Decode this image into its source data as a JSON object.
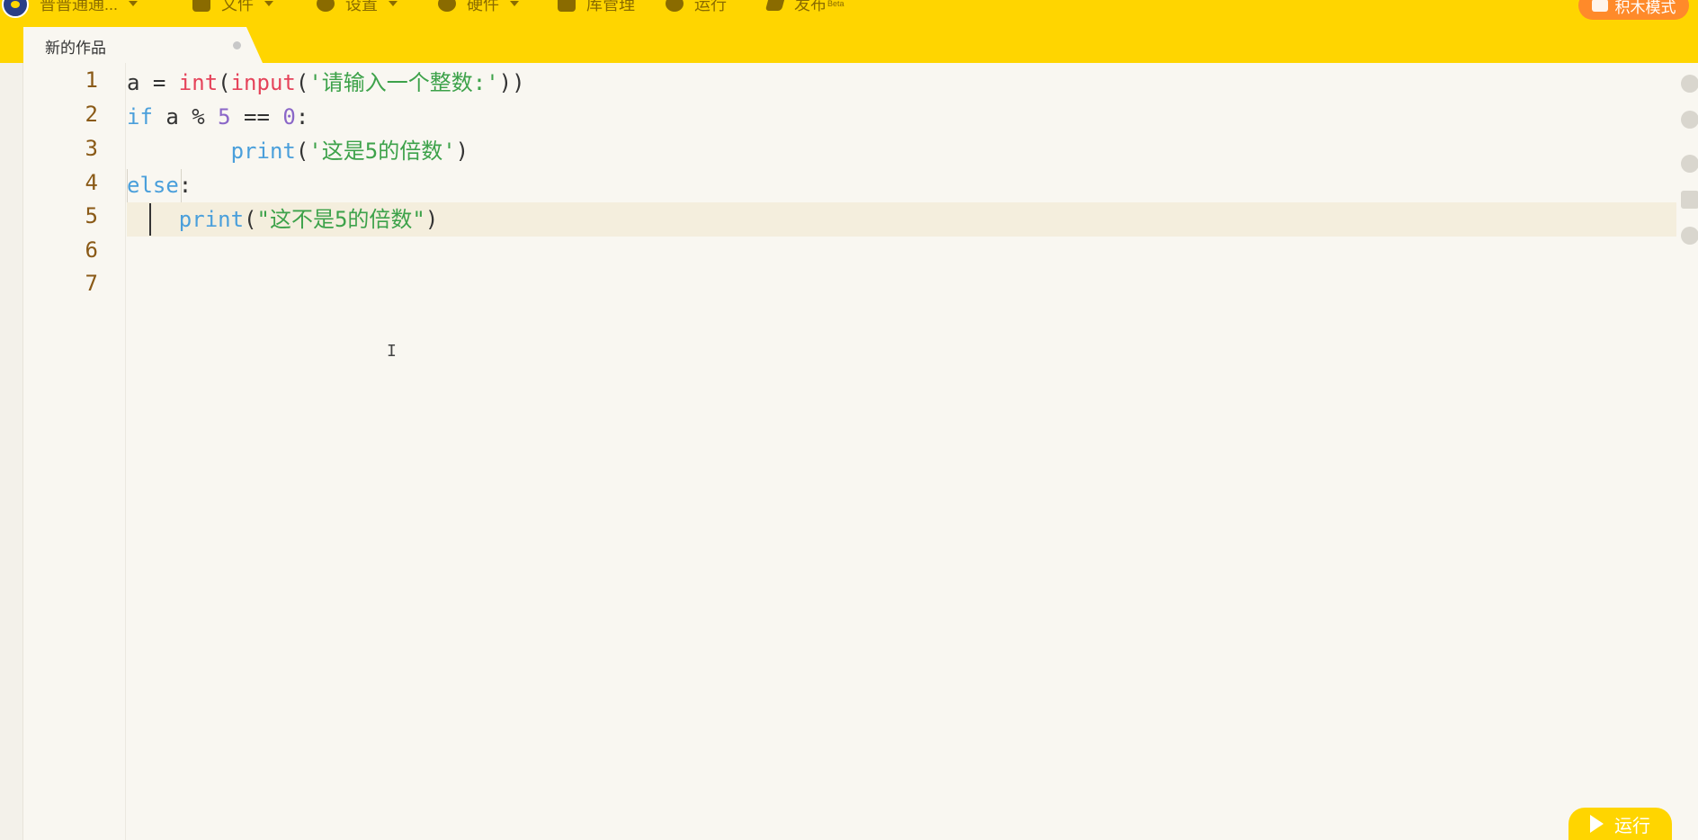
{
  "app": {
    "project_name": "普普通通...",
    "colors": {
      "accent": "#FFD500",
      "block_mode": "#FF8A2A",
      "editor_bg": "#F9F7F1"
    }
  },
  "menu": {
    "file": "文件",
    "settings": "设置",
    "hardware": "硬件",
    "library": "库管理",
    "run": "运行",
    "publish": "发布",
    "publish_badge": "Beta",
    "block_mode": "积木模式"
  },
  "tab": {
    "title": "新的作品"
  },
  "editor": {
    "line_numbers": [
      "1",
      "2",
      "3",
      "4",
      "5",
      "6",
      "7"
    ],
    "current_line": 5,
    "lines": [
      [
        {
          "t": "a = ",
          "c": "plain"
        },
        {
          "t": "int",
          "c": "fn"
        },
        {
          "t": "(",
          "c": "plain"
        },
        {
          "t": "input",
          "c": "fn"
        },
        {
          "t": "(",
          "c": "plain"
        },
        {
          "t": "'请输入一个整数:'",
          "c": "str"
        },
        {
          "t": "))",
          "c": "plain"
        }
      ],
      [
        {
          "t": "if",
          "c": "kw"
        },
        {
          "t": " a % ",
          "c": "plain"
        },
        {
          "t": "5",
          "c": "num"
        },
        {
          "t": " == ",
          "c": "plain"
        },
        {
          "t": "0",
          "c": "num"
        },
        {
          "t": ":",
          "c": "plain"
        }
      ],
      [
        {
          "t": "        ",
          "c": "plain"
        },
        {
          "t": "print",
          "c": "bi"
        },
        {
          "t": "(",
          "c": "plain"
        },
        {
          "t": "'这是5的倍数'",
          "c": "str"
        },
        {
          "t": ")",
          "c": "plain"
        }
      ],
      [
        {
          "t": "else",
          "c": "kw"
        },
        {
          "t": ":",
          "c": "plain"
        }
      ],
      [
        {
          "t": "    ",
          "c": "plain"
        },
        {
          "t": "print",
          "c": "bi"
        },
        {
          "t": "(",
          "c": "plain"
        },
        {
          "t": "\"这不是5的倍数\"",
          "c": "str"
        },
        {
          "t": ")",
          "c": "plain"
        }
      ],
      [],
      []
    ]
  },
  "run_button": {
    "label": "运行"
  },
  "icons": {
    "logo": "app-logo",
    "file": "folder-icon",
    "settings": "gear-icon",
    "hardware": "robot-icon",
    "library": "package-icon",
    "run": "play-circle-icon",
    "publish": "send-icon",
    "undo": "undo-icon",
    "redo": "redo-icon",
    "zoom_in": "zoom-in-icon",
    "format": "format-icon",
    "zoom_out": "zoom-out-icon"
  }
}
